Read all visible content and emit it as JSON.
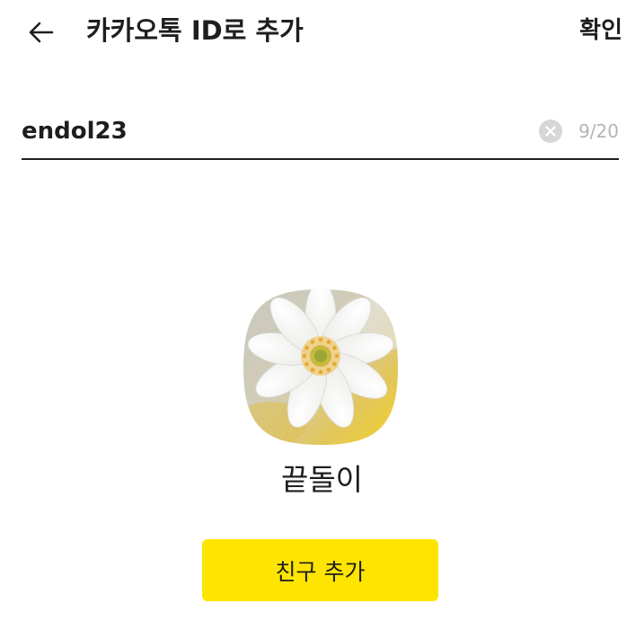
{
  "header": {
    "back_icon": "arrow-left-icon",
    "title": "카카오톡 ID로 추가",
    "confirm_label": "확인"
  },
  "id_search": {
    "value": "endol23",
    "clear_icon": "clear-circle-icon",
    "char_count": "9/20"
  },
  "profile": {
    "avatar_icon": "white-flower-profile-photo",
    "name": "끝돌이"
  },
  "actions": {
    "add_friend_label": "친구 추가"
  },
  "colors": {
    "accent": "#FEE500",
    "text": "#1E1E1E",
    "muted": "#B4B4B4"
  }
}
